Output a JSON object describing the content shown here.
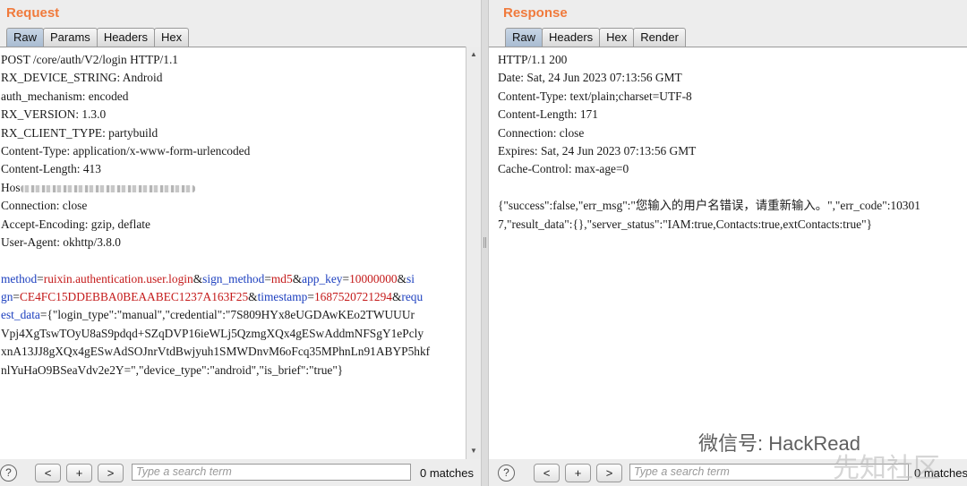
{
  "request": {
    "title": "Request",
    "tabs": [
      "Raw",
      "Params",
      "Headers",
      "Hex"
    ],
    "headers": [
      "POST /core/auth/V2/login HTTP/1.1",
      "RX_DEVICE_STRING: Android",
      "auth_mechanism: encoded",
      "RX_VERSION: 1.3.0",
      "RX_CLIENT_TYPE: partybuild",
      "Content-Type: application/x-www-form-urlencoded",
      "Content-Length: 413",
      "Hos",
      "Connection: close",
      "Accept-Encoding: gzip, deflate",
      "User-Agent: okhttp/3.8.0"
    ],
    "body": {
      "k1": "method",
      "v1": "ruixin.authentication.user.login",
      "k2": "sign_method",
      "v2": "md5",
      "k3": "app_key",
      "v3": "10000000",
      "k4a": "si",
      "k4b": "gn",
      "v4": "CE4FC15DDEBBA0BEAABEC1237A163F25",
      "k5": "timestamp",
      "v5": "1687520721294",
      "k6a": "requ",
      "k6b": "est_data",
      "v6_1": "{\"login_type\":\"manual\",\"credential\":\"7S809HYx8eUGDAwKEo2TWUUUr",
      "v6_2": "Vpj4XgTswTOyU8aS9pdqd+SZqDVP16ieWLj5QzmgXQx4gESwAddmNFSgY1ePcly",
      "v6_3": "xnA13JJ8gXQx4gESwAdSOJnrVtdBwjyuh1SMWDnvM6oFcq35MPhnLn91ABYP5hkf",
      "v6_4": "nlYuHaO9BSeaVdv2e2Y=\",\"device_type\":\"android\",\"is_brief\":\"true\"}"
    },
    "footer": {
      "help": "?",
      "prev": "<",
      "add": "+",
      "next": ">",
      "search_placeholder": "Type a search term",
      "matches": "0 matches"
    }
  },
  "response": {
    "title": "Response",
    "tabs": [
      "Raw",
      "Headers",
      "Hex",
      "Render"
    ],
    "headers": [
      "HTTP/1.1 200",
      "Date: Sat, 24 Jun 2023 07:13:56 GMT",
      "Content-Type: text/plain;charset=UTF-8",
      "Content-Length: 171",
      "Connection: close",
      "Expires: Sat, 24 Jun 2023 07:13:56 GMT",
      "Cache-Control: max-age=0"
    ],
    "body_1": "{\"success\":false,\"err_msg\":\"您输入的用户名错误，请重新输入。\",\"err_code\":10301",
    "body_2": "7,\"result_data\":{},\"server_status\":\"IAM:true,Contacts:true,extContacts:true\"}",
    "footer": {
      "help": "?",
      "prev": "<",
      "add": "+",
      "next": ">",
      "search_placeholder": "Type a search term",
      "matches": "0 matches"
    }
  },
  "watermark": "微信号: HackRead",
  "watermark_logo": "先知社区"
}
